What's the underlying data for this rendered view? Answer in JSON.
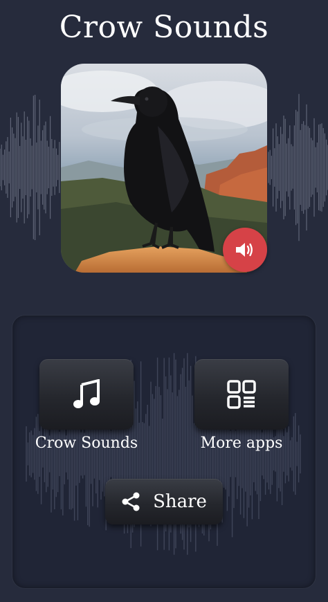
{
  "app": {
    "title": "Crow Sounds"
  },
  "hero": {
    "image_subject": "crow",
    "sound_icon": "speaker-icon"
  },
  "menu": {
    "sounds_label": "Crow Sounds",
    "sounds_icon": "music-note-icon",
    "more_apps_label": "More apps",
    "more_apps_icon": "apps-grid-icon",
    "share_label": "Share",
    "share_icon": "share-icon"
  },
  "colors": {
    "background": "#262b3c",
    "panel": "#202536",
    "accent_red": "#d64247",
    "text": "#ffffff"
  }
}
